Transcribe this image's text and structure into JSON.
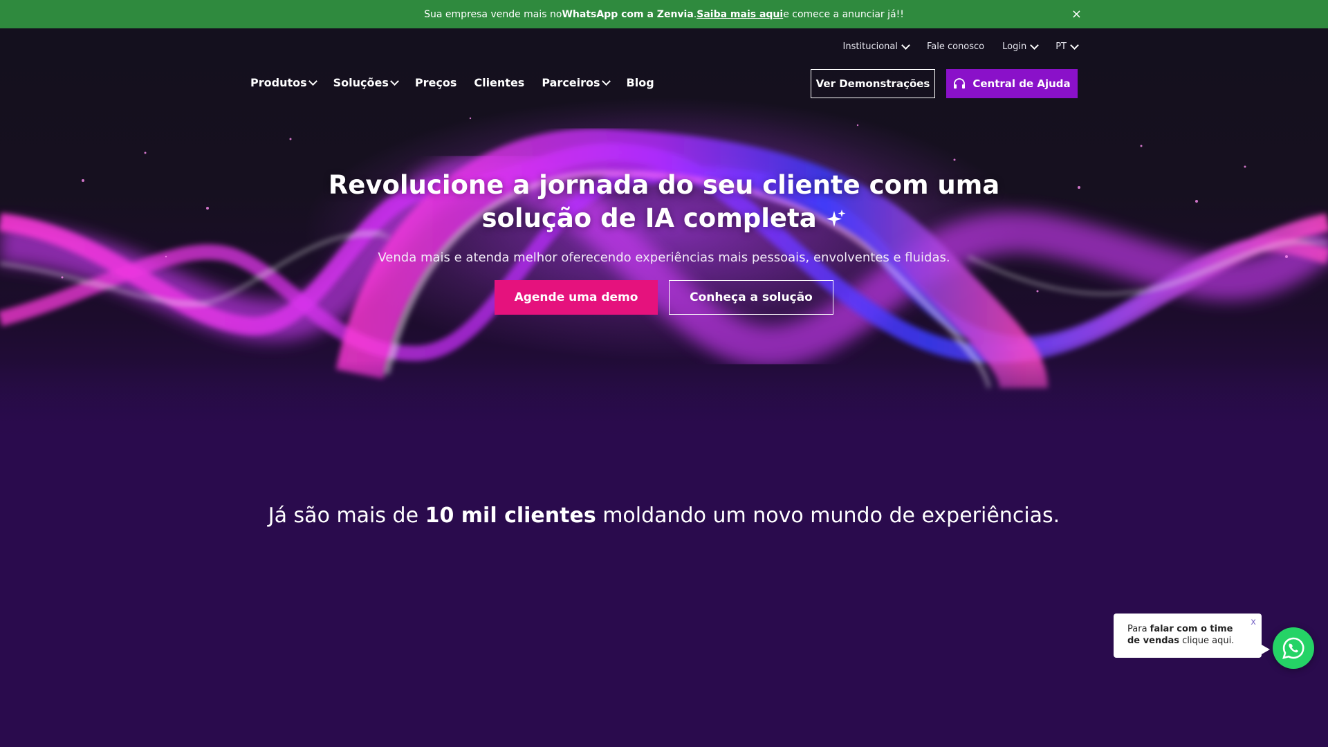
{
  "promo": {
    "text_before": "Sua empresa vende mais no ",
    "text_bold": "WhatsApp com a Zenvia",
    "text_sep": ". ",
    "link_label": "Saiba mais aqui",
    "text_after": " e comece a anunciar já!!",
    "close_label": "×"
  },
  "utility_nav": {
    "items": [
      "Institucional",
      "Fale conosco",
      "Login",
      "PT"
    ]
  },
  "main_nav": {
    "items": [
      "Produtos",
      "Soluções",
      "Preços",
      "Clientes",
      "Parceiros",
      "Blog"
    ]
  },
  "header_actions": {
    "demo_label": "Ver Demonstrações",
    "help_label": "Central de Ajuda"
  },
  "hero": {
    "title_line1": "Revolucione a jornada do seu cliente com uma",
    "title_line2": "solução de IA completa",
    "subtitle": "Venda mais e atenda melhor oferecendo experiências mais pessoais, envolventes e fluidas.",
    "cta_primary": "Agende uma demo",
    "cta_secondary": "Conheça a solução"
  },
  "clients": {
    "before": "Já são mais de ",
    "bold": "10 mil clientes",
    "after": " moldando um novo mundo de experiências."
  },
  "chat": {
    "text_before": "Para ",
    "text_bold": "falar com o time de vendas",
    "text_after": " clique aqui.",
    "close_label": "x"
  },
  "colors": {
    "promo_bg": "#2f8a3e",
    "help_button": "#8a11c9",
    "cta_pink": "#e5127d",
    "page_bg": "#2a0b4d",
    "whatsapp": "#25d366"
  }
}
